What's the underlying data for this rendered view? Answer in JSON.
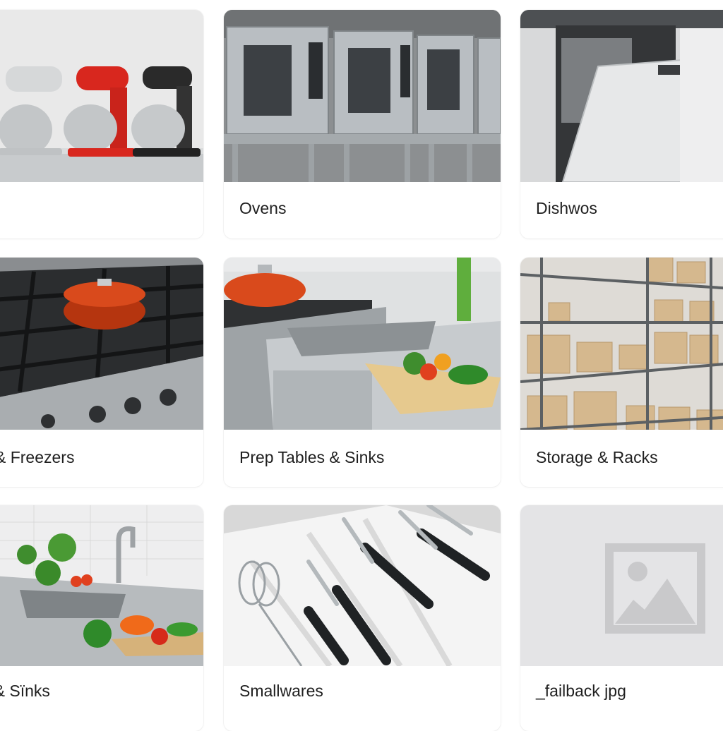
{
  "categories": [
    {
      "label": "",
      "image": "stand-mixers"
    },
    {
      "label": "Ovens",
      "image": "convection-ovens"
    },
    {
      "label": "Dishwos",
      "image": "dishwasher"
    },
    {
      "label": "ge & Freezers",
      "image": "gas-range-with-pot"
    },
    {
      "label": "Prep Tables & Sinks",
      "image": "prep-table-sink"
    },
    {
      "label": "Storage & Racks",
      "image": "storage-shelving"
    },
    {
      "label": "es & Sїnks",
      "image": "sink-with-vegetables"
    },
    {
      "label": "Smallwares",
      "image": "utensil-drawer"
    },
    {
      "label": "_failback jpg",
      "image": "image-placeholder"
    }
  ],
  "colors": {
    "accent_red": "#d8271e",
    "pot_orange": "#d94a1c",
    "steel": "#b9bec2",
    "placeholder_bg": "#e4e4e6",
    "placeholder_icon": "#c9c9cb"
  }
}
